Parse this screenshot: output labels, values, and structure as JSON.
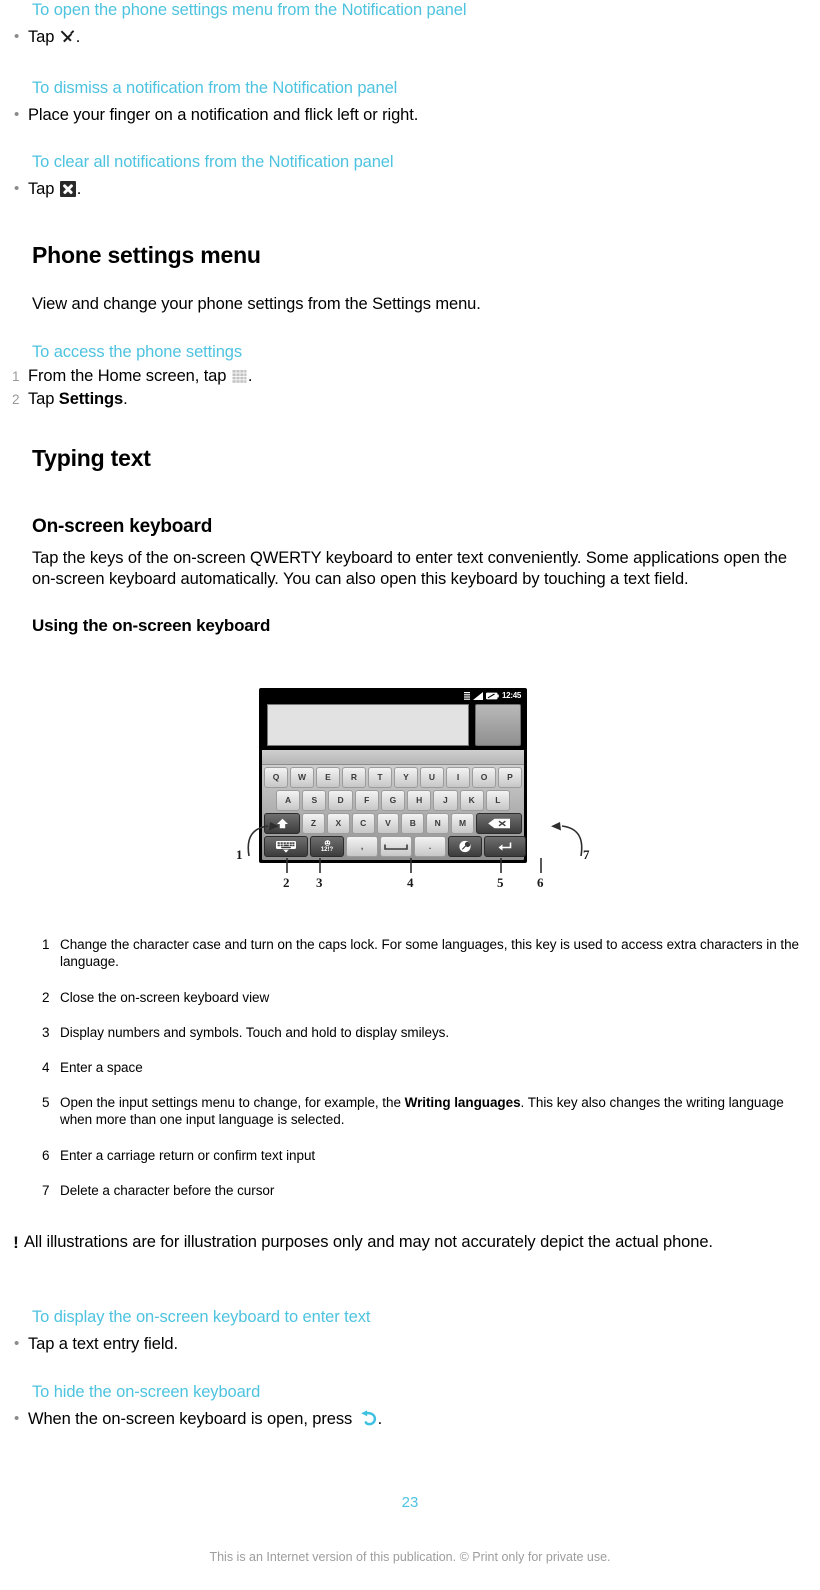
{
  "page": {
    "number": "23",
    "footer": "This is an Internet version of this publication. © Print only for private use.",
    "accent_color": "#4ec3e0"
  },
  "sections": {
    "notification_tasks": [
      {
        "heading": "To open the phone settings menu from the Notification panel",
        "step_prefix": "Tap ",
        "icon": "tool-icon",
        "step_suffix": "."
      },
      {
        "heading": "To dismiss a notification from the Notification panel",
        "step_prefix": "Place your finger on a notification and flick left or right.",
        "icon": "",
        "step_suffix": ""
      },
      {
        "heading": "To clear all notifications from the Notification panel",
        "step_prefix": "Tap ",
        "icon": "clear-all-icon",
        "step_suffix": "."
      }
    ],
    "phone_settings": {
      "title": "Phone settings menu",
      "intro": "View and change your phone settings from the Settings menu.",
      "task_heading": "To access the phone settings",
      "steps": [
        {
          "num": "1",
          "text_before": "From the Home screen, tap ",
          "icon": "app-grid-icon",
          "text_after": "."
        },
        {
          "num": "2",
          "text_before": "Tap ",
          "bold": "Settings",
          "text_after": "."
        }
      ]
    },
    "typing_text": {
      "title": "Typing text",
      "onscreen_keyboard": {
        "title": "On-screen keyboard",
        "paragraph": "Tap the keys of the on-screen QWERTY keyboard to enter text conveniently. Some applications open the on-screen keyboard automatically. You can also open this keyboard by touching a text field."
      },
      "using_keyboard": {
        "title": "Using the on-screen keyboard"
      }
    },
    "legend": [
      {
        "num": "1",
        "text": "Change the character case and turn on the caps lock. For some languages, this key is used to access extra characters in the language."
      },
      {
        "num": "2",
        "text": "Close the on-screen keyboard view"
      },
      {
        "num": "3",
        "text": "Display numbers and symbols. Touch and hold to display smileys."
      },
      {
        "num": "4",
        "text": "Enter a space"
      },
      {
        "num": "5",
        "text_before": "Open the input settings menu to change, for example, the ",
        "bold": "Writing languages",
        "text_after": ". This key also changes the writing language when more than one input language is selected."
      },
      {
        "num": "6",
        "text": "Enter a carriage return or confirm text input"
      },
      {
        "num": "7",
        "text": "Delete a character before the cursor"
      }
    ],
    "note": {
      "icon": "exclamation-icon",
      "text": "All illustrations are for illustration purposes only and may not accurately depict the actual phone."
    },
    "keyboard_tasks": [
      {
        "heading": "To display the on-screen keyboard to enter text",
        "step_prefix": "Tap a text entry field.",
        "icon": "",
        "step_suffix": ""
      },
      {
        "heading": "To hide the on-screen keyboard",
        "step_prefix": "When the on-screen keyboard is open, press ",
        "icon": "back-arrow-icon",
        "step_suffix": "."
      }
    ]
  },
  "keyboard_figure": {
    "status_bar": {
      "clock": "12:45",
      "icons": [
        "sim-icon",
        "signal-icon",
        "battery-icon"
      ]
    },
    "rows": {
      "row1": [
        "Q",
        "W",
        "E",
        "R",
        "T",
        "Y",
        "U",
        "I",
        "O",
        "P"
      ],
      "row2": [
        "A",
        "S",
        "D",
        "F",
        "G",
        "H",
        "J",
        "K",
        "L"
      ],
      "row3": [
        "Z",
        "X",
        "C",
        "V",
        "B",
        "N",
        "M"
      ],
      "shift_key": "shift-icon",
      "backspace_key": "backspace-icon",
      "hide_key": "hide-keyboard-icon",
      "symbol_key": "12!?",
      "comma_key": ",",
      "space_key": "space-icon",
      "period_key": ".",
      "settings_key": "input-settings-icon",
      "enter_key": "enter-icon"
    },
    "callouts": [
      "1",
      "2",
      "3",
      "4",
      "5",
      "6",
      "7"
    ]
  }
}
